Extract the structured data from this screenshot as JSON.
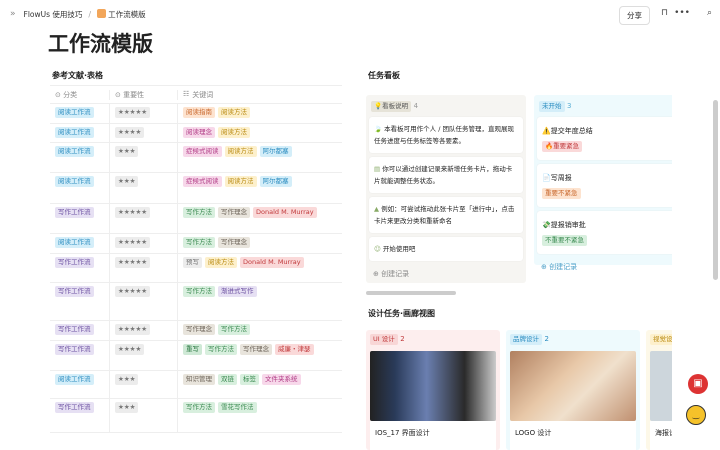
{
  "breadcrumb": {
    "parent": "FlowUs 使用技巧",
    "current": "工作流模版"
  },
  "toolbar": {
    "share": "分享",
    "more": "•••"
  },
  "title": "工作流模版",
  "table": {
    "title": "参考文献·表格",
    "headers": [
      "分类",
      "重要性",
      "关键词"
    ],
    "rows": [
      {
        "cat": "阅读工作流",
        "c": "blue",
        "stars": "★★★★★",
        "tags": [
          [
            "阅读指南",
            "orange"
          ],
          [
            "阅读方法",
            "yellow"
          ]
        ]
      },
      {
        "cat": "阅读工作流",
        "c": "blue",
        "stars": "★★★★",
        "tags": [
          [
            "阅读理念",
            "pink"
          ],
          [
            "阅读方法",
            "yellow"
          ]
        ]
      },
      {
        "cat": "阅读工作流",
        "c": "blue",
        "stars": "★★★",
        "tags": [
          [
            "症候式阅读",
            "pink"
          ],
          [
            "阅读方法",
            "yellow"
          ],
          [
            "阿尔都塞",
            "blue"
          ]
        ]
      },
      {
        "cat": "阅读工作流",
        "c": "blue",
        "stars": "★★★",
        "tags": [
          [
            "症候式阅读",
            "pink"
          ],
          [
            "阅读方法",
            "yellow"
          ],
          [
            "阿尔都塞",
            "blue"
          ]
        ]
      },
      {
        "cat": "写作工作流",
        "c": "purple",
        "stars": "★★★★★",
        "tags": [
          [
            "写作方法",
            "green"
          ],
          [
            "写作理念",
            "brown"
          ],
          [
            "Donald M. Murray",
            "red"
          ]
        ]
      },
      {
        "cat": "阅读工作流",
        "c": "blue",
        "stars": "★★★★★",
        "tags": [
          [
            "写作方法",
            "green"
          ],
          [
            "写作理念",
            "brown"
          ]
        ]
      },
      {
        "cat": "写作工作流",
        "c": "purple",
        "stars": "★★★★★",
        "tags": [
          [
            "预写",
            "gray"
          ],
          [
            "阅读方法",
            "yellow"
          ],
          [
            "Donald M. Murray",
            "red"
          ]
        ]
      },
      {
        "cat": "写作工作流",
        "c": "purple",
        "stars": "★★★★★",
        "tags": [
          [
            "写作方法",
            "green"
          ],
          [
            "渐进式写作",
            "purple"
          ]
        ]
      },
      {
        "cat": "写作工作流",
        "c": "purple",
        "stars": "★★★★★",
        "tags": [
          [
            "写作理念",
            "brown"
          ],
          [
            "写作方法",
            "green"
          ]
        ]
      },
      {
        "cat": "写作工作流",
        "c": "purple",
        "stars": "★★★★",
        "tags": [
          [
            "重写",
            "green2"
          ],
          [
            "写作方法",
            "green"
          ],
          [
            "写作理念",
            "brown"
          ],
          [
            "威廉・津瑟",
            "red"
          ]
        ]
      },
      {
        "cat": "阅读工作流",
        "c": "blue",
        "stars": "★★★",
        "tags": [
          [
            "知识管理",
            "brown"
          ],
          [
            "双链",
            "green"
          ],
          [
            "标签",
            "green"
          ],
          [
            "文件夹系统",
            "pink"
          ]
        ]
      },
      {
        "cat": "写作工作流",
        "c": "purple",
        "stars": "★★★",
        "tags": [
          [
            "写作方法",
            "green"
          ],
          [
            "雪花写作法",
            "green"
          ]
        ]
      }
    ]
  },
  "board": {
    "title": "任务看板",
    "col1": {
      "label": "看板说明",
      "count": "4",
      "cards": [
        "本看板可用作个人 / 团队任务管理，直观展现任务进度与任务标签等各要素。",
        "你可以通过创建记录来新增任务卡片，拖动卡片就能调整任务状态。",
        "例如：可尝试拖动此张卡片至「进行中」，点击卡片来更改分类和重新命名",
        "开始使用吧"
      ],
      "add": "创建记录"
    },
    "col2": {
      "label": "未开始",
      "count": "3",
      "cards": [
        {
          "t": "⚠️提交年度总结",
          "tag": "🔥重要紧急",
          "c": "red"
        },
        {
          "t": "📄写周报",
          "tag": "重要不紧急",
          "c": "orange"
        },
        {
          "t": "💸提报销审批",
          "tag": "不重要不紧急",
          "c": "green"
        }
      ],
      "add": "创建记录"
    }
  },
  "gallery": {
    "title": "设计任务·画廊视图",
    "groups": [
      {
        "label": "UI 设计",
        "count": "2",
        "card": "IOS_17 界面设计"
      },
      {
        "label": "品牌设计",
        "count": "2",
        "card": "LOGO 设计"
      },
      {
        "label": "视觉设",
        "card": "海报设"
      }
    ]
  },
  "colors": {
    "blue": [
      "#d4eef9",
      "#2a8cc0"
    ],
    "purple": [
      "#e6e0f3",
      "#6b4fa0"
    ],
    "gray": [
      "#ececec",
      "#777"
    ],
    "orange": [
      "#fde3cf",
      "#c8662a"
    ],
    "yellow": [
      "#fdf0cc",
      "#b98a10"
    ],
    "pink": [
      "#f7d8ea",
      "#b03a85"
    ],
    "green": [
      "#d8efde",
      "#3a8a50"
    ],
    "green2": [
      "#cfe9d6",
      "#2d7a44"
    ],
    "brown": [
      "#e8e4dc",
      "#6b6257"
    ],
    "red": [
      "#fad9d9",
      "#c0393b"
    ]
  }
}
